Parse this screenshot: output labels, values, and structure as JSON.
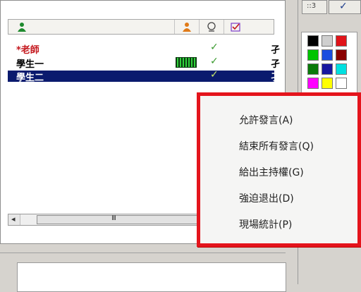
{
  "users": [
    {
      "name": "*老師",
      "color": "#c4161c",
      "has_check": true,
      "selected": false,
      "extra": "孑"
    },
    {
      "name": "學生一",
      "color": "#000000",
      "has_check": true,
      "selected": false,
      "extra": "孑"
    },
    {
      "name": "學生二",
      "color": "#ffffff",
      "has_check": true,
      "selected": true,
      "extra": "孑"
    }
  ],
  "scrollbar": {
    "thumb_glyph": "III",
    "left_arrow": "◂"
  },
  "context_menu": {
    "items": [
      "允許發言(A)",
      "結束所有發言(Q)",
      "給出主持權(G)",
      "強迫退出(D)",
      "現場統計(P)"
    ]
  },
  "toolbar": {
    "left_glyph": "::3",
    "right_glyph": "✓"
  },
  "palette": {
    "colors": [
      "#000000",
      "#cfcfcf",
      "#e0141a",
      "#00c400",
      "#1a4de0",
      "#8a0000",
      "#0a7a0a",
      "#1818a0",
      "#00e0e0",
      "#ff00ff",
      "#ffff00",
      "#ffffff"
    ]
  }
}
